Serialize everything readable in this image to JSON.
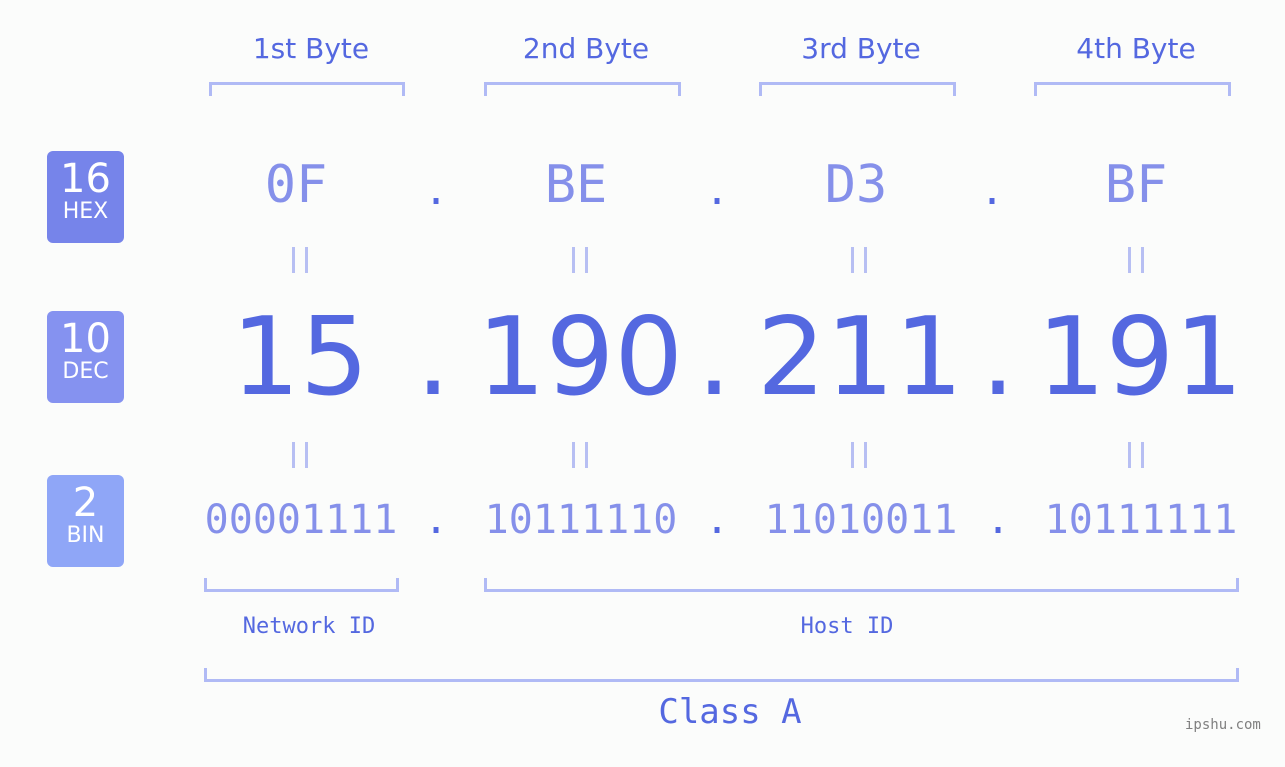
{
  "headers": [
    "1st Byte",
    "2nd Byte",
    "3rd Byte",
    "4th Byte"
  ],
  "badges": [
    {
      "num": "16",
      "label": "HEX",
      "color": "#7684ea"
    },
    {
      "num": "10",
      "label": "DEC",
      "color": "#8592f0"
    },
    {
      "num": "2",
      "label": "BIN",
      "color": "#8fa6f7"
    }
  ],
  "hex": [
    "0F",
    "BE",
    "D3",
    "BF"
  ],
  "dec": [
    "15",
    "190",
    "211",
    "191"
  ],
  "bin": [
    "00001111",
    "10111110",
    "11010011",
    "10111111"
  ],
  "separator": ".",
  "network_label": "Network ID",
  "host_label": "Host ID",
  "class_label": "Class A",
  "watermark": "ipshu.com"
}
